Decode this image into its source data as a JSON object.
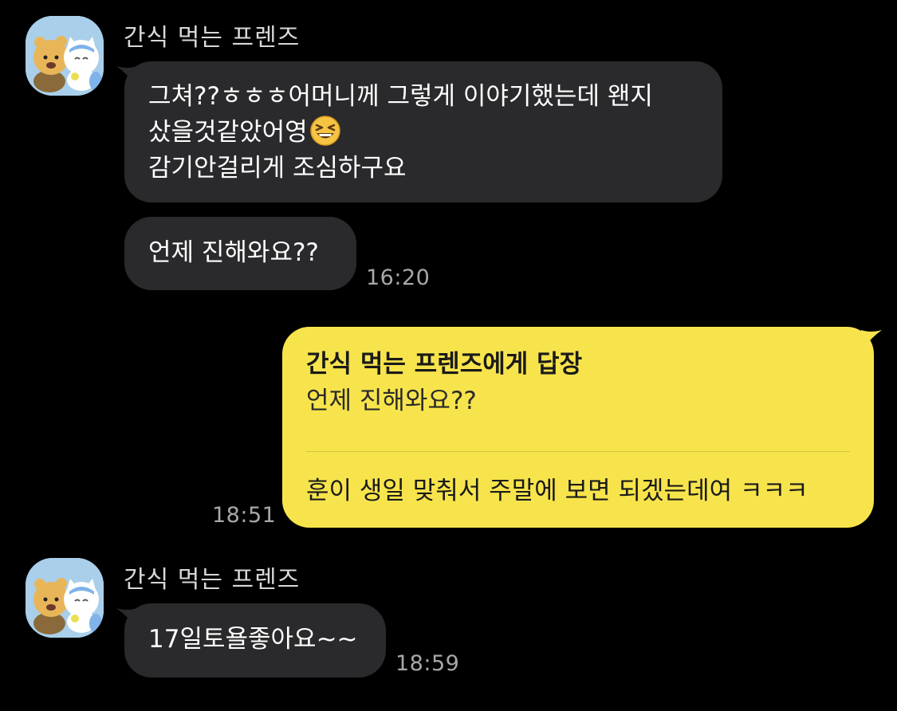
{
  "chat": {
    "group1": {
      "sender": "간식 먹는 프렌즈",
      "bubble1": {
        "line1": "그쳐??ㅎㅎㅎ어머니께 그렇게 이야기했는데 왠지",
        "line2": "샀을것같았어영",
        "line3": "감기안걸리게 조심하구요",
        "emoji": "grinning-squinting-face"
      },
      "bubble2": {
        "text": "언제 진해와요??",
        "time": "16:20"
      }
    },
    "mine": {
      "time": "18:51",
      "reply_header": "간식 먹는 프렌즈에게 답장",
      "reply_quote": "언제 진해와요??",
      "message": "훈이 생일 맞춰서 주말에 보면 되겠는데여 ㅋㅋㅋ"
    },
    "group2": {
      "sender": "간식 먹는 프렌즈",
      "bubble1": {
        "text": "17일토욜좋아요~~",
        "time": "18:59"
      }
    },
    "colors": {
      "background": "#000000",
      "incoming_bubble": "#2a2a2c",
      "outgoing_bubble": "#f7e44c",
      "avatar_bg": "#a9cfea"
    }
  }
}
